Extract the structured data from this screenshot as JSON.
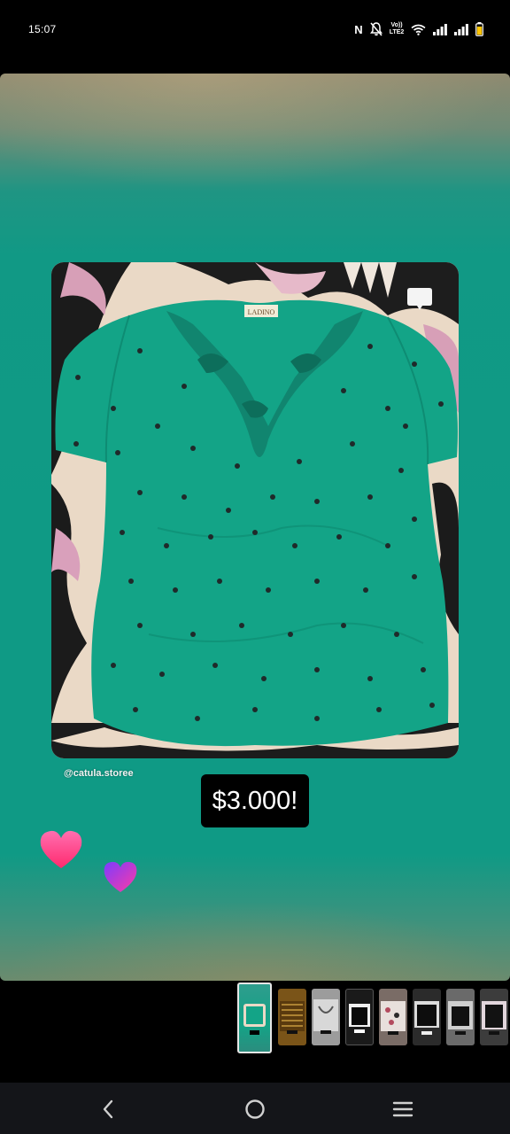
{
  "status_bar": {
    "time": "15:07",
    "nfc": "N",
    "volte_top": "Vo))",
    "volte_bottom": "LTE2",
    "icons": [
      "nfc-icon",
      "bell-off-icon",
      "volte-icon",
      "wifi-icon",
      "signal-icon",
      "signal-icon",
      "battery-icon"
    ],
    "battery_color": "#ffc400"
  },
  "story": {
    "watermark": "@catula.storee",
    "price": "$3.000!",
    "background_color": "#0f9a85",
    "stickers": [
      "heart-pink-icon",
      "heart-purple-icon"
    ],
    "photo_icon": "chat-bubble-icon"
  },
  "thumbnails": [
    {
      "name": "green-shirt",
      "active": true
    },
    {
      "name": "brown-item",
      "active": false
    },
    {
      "name": "grey-item",
      "active": false
    },
    {
      "name": "black-item",
      "active": false
    },
    {
      "name": "floral-item",
      "active": false
    },
    {
      "name": "black-item-2",
      "active": false
    },
    {
      "name": "black-item-3",
      "active": false
    },
    {
      "name": "black-item-4",
      "active": false
    }
  ],
  "nav_bar": {
    "buttons": [
      "back-icon",
      "home-icon",
      "recents-icon"
    ]
  }
}
